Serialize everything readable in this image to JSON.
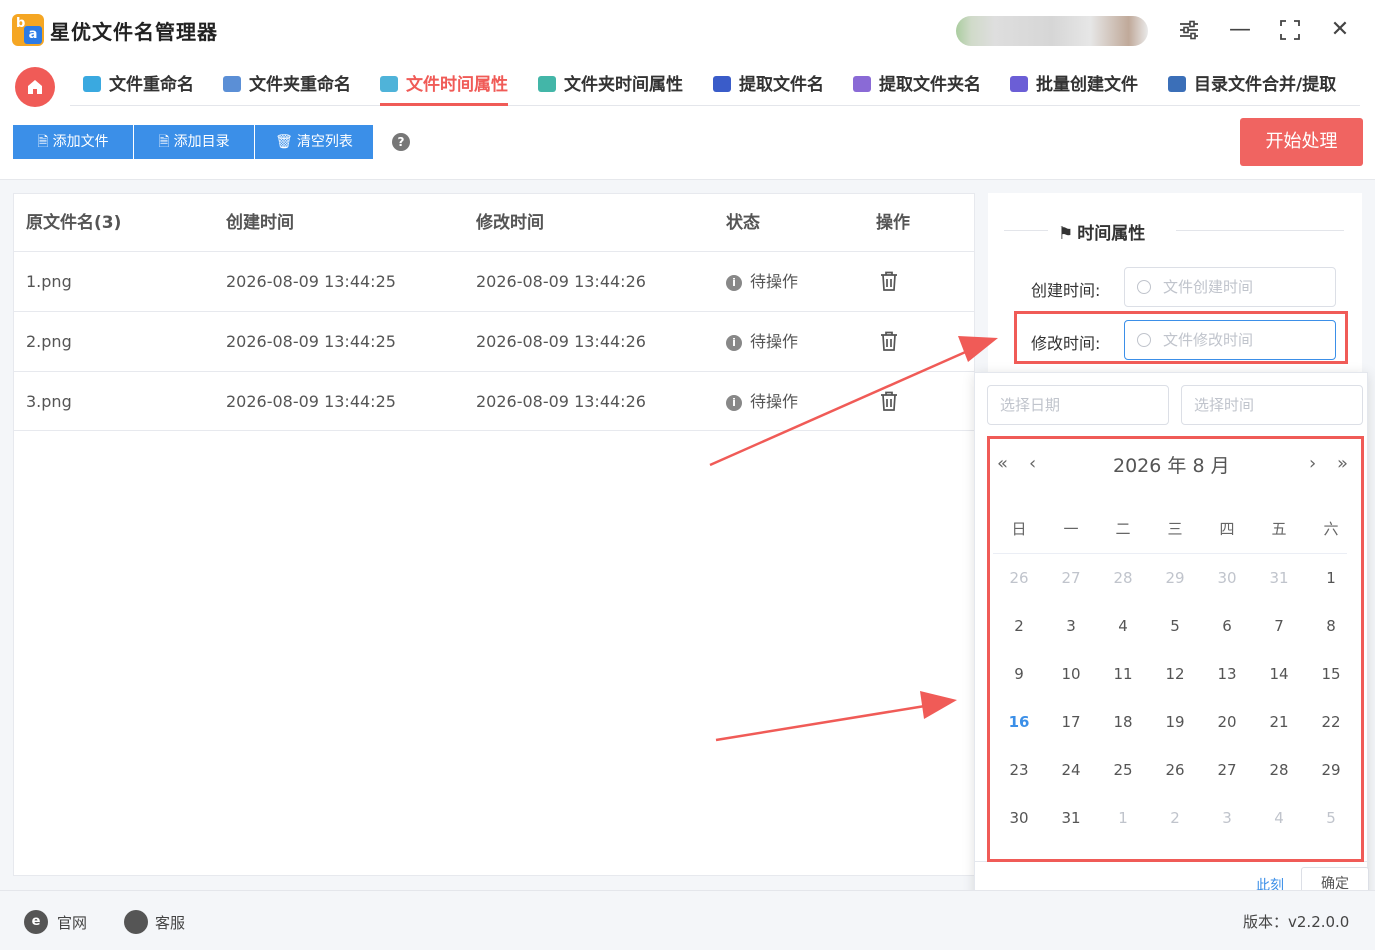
{
  "app": {
    "title": "星优文件名管理器",
    "logo_letters": {
      "b": "b",
      "a": "a"
    }
  },
  "window": {
    "settings_icon": "sliders-icon",
    "minimize": "—",
    "maximize": "⛶",
    "close": "✕"
  },
  "nav": {
    "home_icon": "⌂",
    "tabs": [
      {
        "label": "文件重命名",
        "color": "#3aa9e0"
      },
      {
        "label": "文件夹重命名",
        "color": "#5b8fd6"
      },
      {
        "label": "文件时间属性",
        "color": "#4fb3d9",
        "active": true
      },
      {
        "label": "文件夹时间属性",
        "color": "#43b6a8"
      },
      {
        "label": "提取文件名",
        "color": "#3a5cc9"
      },
      {
        "label": "提取文件夹名",
        "color": "#8a6ad6"
      },
      {
        "label": "批量创建文件",
        "color": "#6b5ed6"
      },
      {
        "label": "目录文件合并/提取",
        "color": "#3b6fb8"
      }
    ]
  },
  "toolbar": {
    "add_file": "添加文件",
    "add_dir": "添加目录",
    "clear_list": "清空列表",
    "help": "?",
    "start": "开始处理",
    "file_icon": "🗎",
    "trash_icon": "🗑"
  },
  "table": {
    "headers": {
      "name": "原文件名(3)",
      "created": "创建时间",
      "modified": "修改时间",
      "status": "状态",
      "action": "操作"
    },
    "rows": [
      {
        "name": "1.png",
        "created": "2026-08-09 13:44:25",
        "modified": "2026-08-09 13:44:26",
        "status": "待操作"
      },
      {
        "name": "2.png",
        "created": "2026-08-09 13:44:25",
        "modified": "2026-08-09 13:44:26",
        "status": "待操作"
      },
      {
        "name": "3.png",
        "created": "2026-08-09 13:44:25",
        "modified": "2026-08-09 13:44:26",
        "status": "待操作"
      }
    ],
    "info_glyph": "i"
  },
  "panel": {
    "title": "时间属性",
    "flag_icon": "⚑",
    "created_label": "创建时间:",
    "created_placeholder": "文件创建时间",
    "modified_label": "修改时间:",
    "modified_placeholder": "文件修改时间"
  },
  "picker": {
    "date_placeholder": "选择日期",
    "time_placeholder": "选择时间",
    "prev_year": "«",
    "prev_month": "‹",
    "next_month": "›",
    "next_year": "»",
    "year": "2026",
    "year_suffix": "年",
    "month": "8",
    "month_suffix": "月",
    "weekdays": [
      "日",
      "一",
      "二",
      "三",
      "四",
      "五",
      "六"
    ],
    "weeks": [
      [
        {
          "d": "26",
          "t": "prev"
        },
        {
          "d": "27",
          "t": "prev"
        },
        {
          "d": "28",
          "t": "prev"
        },
        {
          "d": "29",
          "t": "prev"
        },
        {
          "d": "30",
          "t": "prev"
        },
        {
          "d": "31",
          "t": "prev"
        },
        {
          "d": "1",
          "t": "cur"
        }
      ],
      [
        {
          "d": "2",
          "t": "cur"
        },
        {
          "d": "3",
          "t": "cur"
        },
        {
          "d": "4",
          "t": "cur"
        },
        {
          "d": "5",
          "t": "cur"
        },
        {
          "d": "6",
          "t": "cur"
        },
        {
          "d": "7",
          "t": "cur"
        },
        {
          "d": "8",
          "t": "cur"
        }
      ],
      [
        {
          "d": "9",
          "t": "cur"
        },
        {
          "d": "10",
          "t": "cur"
        },
        {
          "d": "11",
          "t": "cur"
        },
        {
          "d": "12",
          "t": "cur"
        },
        {
          "d": "13",
          "t": "cur"
        },
        {
          "d": "14",
          "t": "cur"
        },
        {
          "d": "15",
          "t": "cur"
        }
      ],
      [
        {
          "d": "16",
          "t": "today"
        },
        {
          "d": "17",
          "t": "cur"
        },
        {
          "d": "18",
          "t": "cur"
        },
        {
          "d": "19",
          "t": "cur"
        },
        {
          "d": "20",
          "t": "cur"
        },
        {
          "d": "21",
          "t": "cur"
        },
        {
          "d": "22",
          "t": "cur"
        }
      ],
      [
        {
          "d": "23",
          "t": "cur"
        },
        {
          "d": "24",
          "t": "cur"
        },
        {
          "d": "25",
          "t": "cur"
        },
        {
          "d": "26",
          "t": "cur"
        },
        {
          "d": "27",
          "t": "cur"
        },
        {
          "d": "28",
          "t": "cur"
        },
        {
          "d": "29",
          "t": "cur"
        }
      ],
      [
        {
          "d": "30",
          "t": "cur"
        },
        {
          "d": "31",
          "t": "cur"
        },
        {
          "d": "1",
          "t": "next"
        },
        {
          "d": "2",
          "t": "next"
        },
        {
          "d": "3",
          "t": "next"
        },
        {
          "d": "4",
          "t": "next"
        },
        {
          "d": "5",
          "t": "next"
        }
      ]
    ],
    "now": "此刻",
    "confirm": "确定"
  },
  "footer": {
    "website": "官网",
    "website_icon": "e",
    "service": "客服",
    "service_icon": "●",
    "version": "版本：v2.2.0.0"
  },
  "colors": {
    "accent": "#f05b57",
    "primary": "#3b8fe8",
    "annotation": "#f05b57"
  }
}
